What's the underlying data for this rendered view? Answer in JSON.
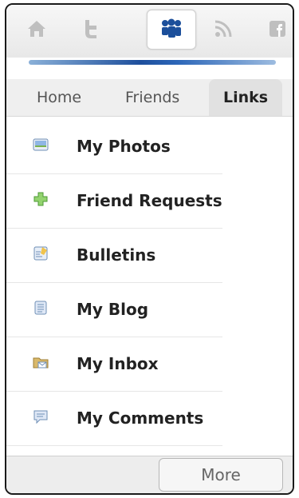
{
  "top_icons": [
    {
      "name": "home-icon",
      "active": false
    },
    {
      "name": "twitter-icon",
      "active": false
    },
    {
      "name": "myspace-icon",
      "active": true
    },
    {
      "name": "rss-icon",
      "active": false
    },
    {
      "name": "facebook-icon",
      "active": false
    }
  ],
  "tabs": [
    {
      "label": "Home",
      "active": false
    },
    {
      "label": "Friends",
      "active": false
    },
    {
      "label": "Links",
      "active": true
    }
  ],
  "links": [
    {
      "label": "My Photos",
      "icon": "photo-icon"
    },
    {
      "label": "Friend Requests",
      "icon": "add-friend-icon"
    },
    {
      "label": "Bulletins",
      "icon": "bulletin-icon"
    },
    {
      "label": "My Blog",
      "icon": "blog-icon"
    },
    {
      "label": "My Inbox",
      "icon": "inbox-icon"
    },
    {
      "label": "My Comments",
      "icon": "comments-icon"
    }
  ],
  "footer": {
    "more_label": "More"
  },
  "colors": {
    "accent": "#1e4f9c",
    "active_tab_bg": "#e1e1e1"
  }
}
